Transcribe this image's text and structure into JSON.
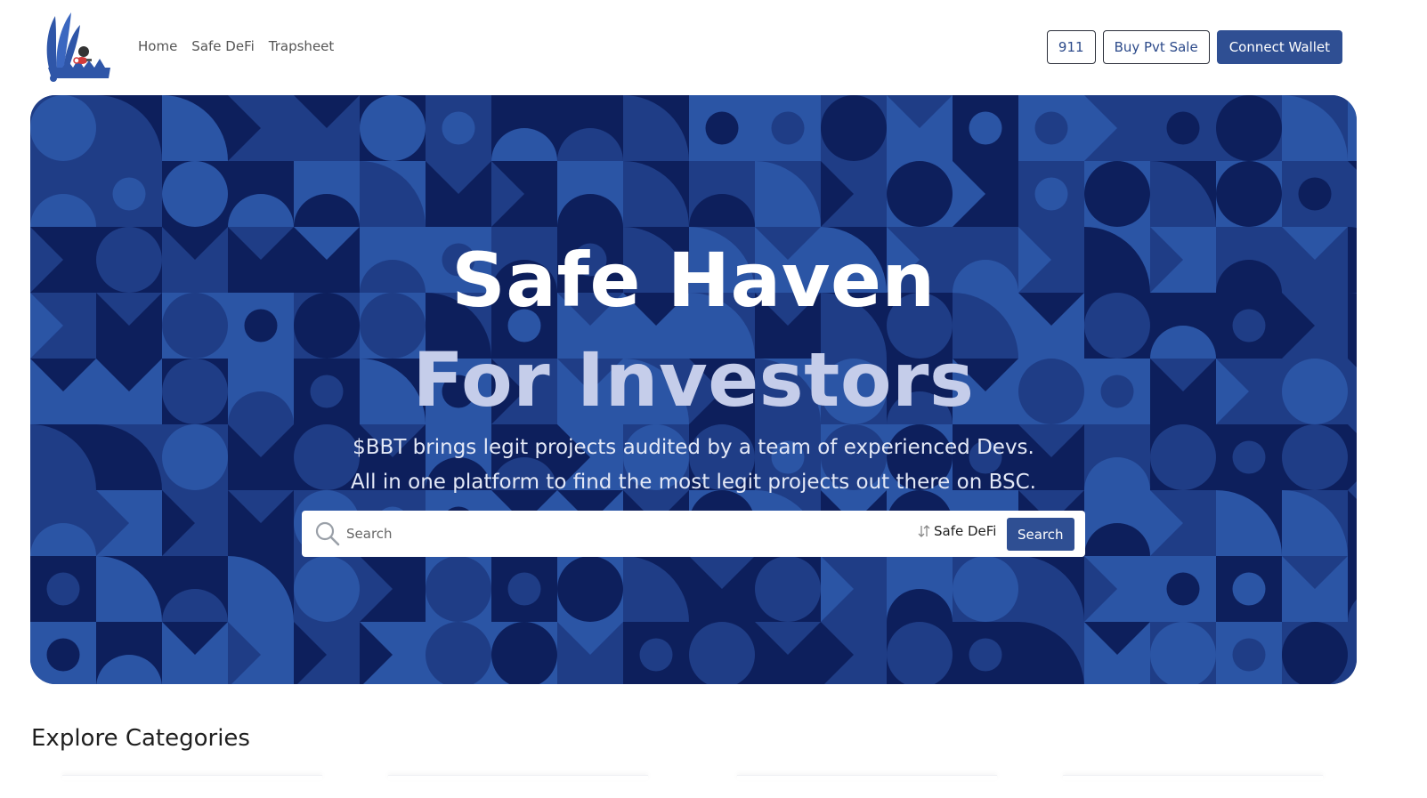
{
  "header": {
    "logo_icon": "trap-logo-icon",
    "nav": [
      {
        "label": "Home"
      },
      {
        "label": "Safe DeFi"
      },
      {
        "label": "Trapsheet"
      }
    ],
    "buttons": {
      "emergency": "911",
      "buy": "Buy Pvt Sale",
      "connect": "Connect Wallet"
    },
    "colors": {
      "primary": "#2f4f93"
    }
  },
  "hero": {
    "title_line1": "Safe Haven",
    "title_line2": "For Investors",
    "subtitle_line1": "$BBT brings legit projects audited by a team of experienced Devs.",
    "subtitle_line2": "All in one platform to find the most legit projects out there on BSC.",
    "search": {
      "placeholder": "Search",
      "value": "",
      "filter_selected": "Safe DeFi",
      "button_label": "Search"
    },
    "colors": {
      "dark": "#0d1f5c",
      "mid": "#1f3d86",
      "light": "#2b55a5"
    }
  },
  "categories": {
    "title": "Explore Categories"
  }
}
